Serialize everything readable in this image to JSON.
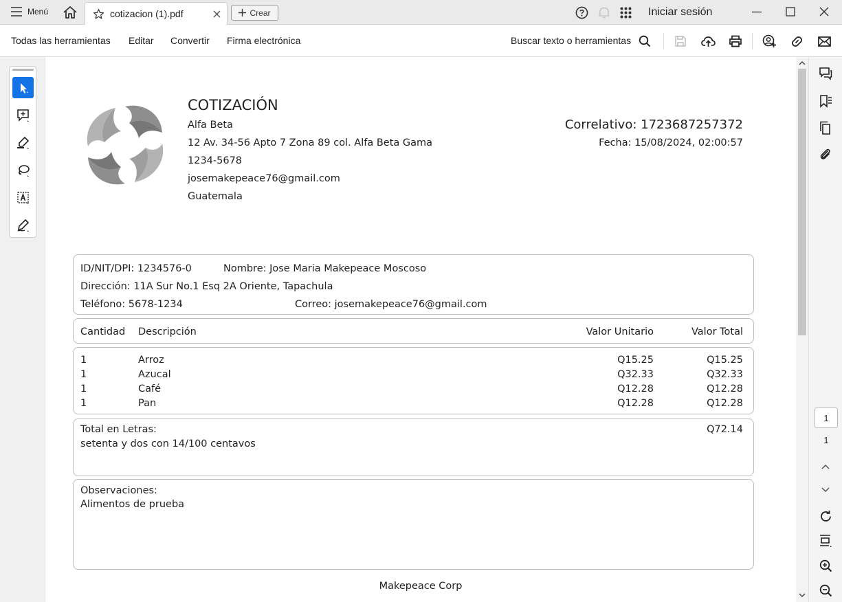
{
  "titlebar": {
    "menu_label": "Menú",
    "tab_title": "cotizacion (1).pdf",
    "create_label": "Crear",
    "signin_label": "Iniciar sesión"
  },
  "toolbar": {
    "menu_items": [
      "Todas las herramientas",
      "Editar",
      "Convertir",
      "Firma electrónica"
    ],
    "search_label": "Buscar texto o herramientas"
  },
  "document": {
    "header": {
      "title": "COTIZACIÓN",
      "company": "Alfa Beta",
      "address": "12 Av. 34-56 Apto 7 Zona 89 col. Alfa Beta Gama",
      "phone": "1234-5678",
      "email": "josemakepeace76@gmail.com",
      "country": "Guatemala",
      "correlativo": "Correlativo: 1723687257372",
      "fecha": "Fecha: 15/08/2024, 02:00:57"
    },
    "client": {
      "id": "ID/NIT/DPI: 1234576-0",
      "name": "Nombre: Jose Maria Makepeace Moscoso",
      "address": "Dirección: 11A Sur No.1 Esq 2A Oriente, Tapachula",
      "phone": "Teléfono: 5678-1234",
      "email": "Correo: josemakepeace76@gmail.com"
    },
    "columns": {
      "qty": "Cantidad",
      "desc": "Descripción",
      "unit": "Valor Unitario",
      "total": "Valor Total"
    },
    "items": [
      {
        "qty": "1",
        "desc": "Arroz",
        "unit": "Q15.25",
        "total": "Q15.25"
      },
      {
        "qty": "1",
        "desc": "Azucal",
        "unit": "Q32.33",
        "total": "Q32.33"
      },
      {
        "qty": "1",
        "desc": "Café",
        "unit": "Q12.28",
        "total": "Q12.28"
      },
      {
        "qty": "1",
        "desc": "Pan",
        "unit": "Q12.28",
        "total": "Q12.28"
      }
    ],
    "total": {
      "label": "Total en Letras:",
      "amount": "Q72.14",
      "words": "setenta y dos con 14/100 centavos"
    },
    "observations": {
      "label": "Observaciones:",
      "text": "Alimentos de prueba"
    },
    "footer": "Makepeace Corp"
  },
  "navigation": {
    "current_page": "1",
    "total_pages": "1"
  },
  "colors": {
    "accent": "#1473e6",
    "titlebar_bg": "#eaeaea",
    "panel_bg": "#f0f0f0"
  }
}
